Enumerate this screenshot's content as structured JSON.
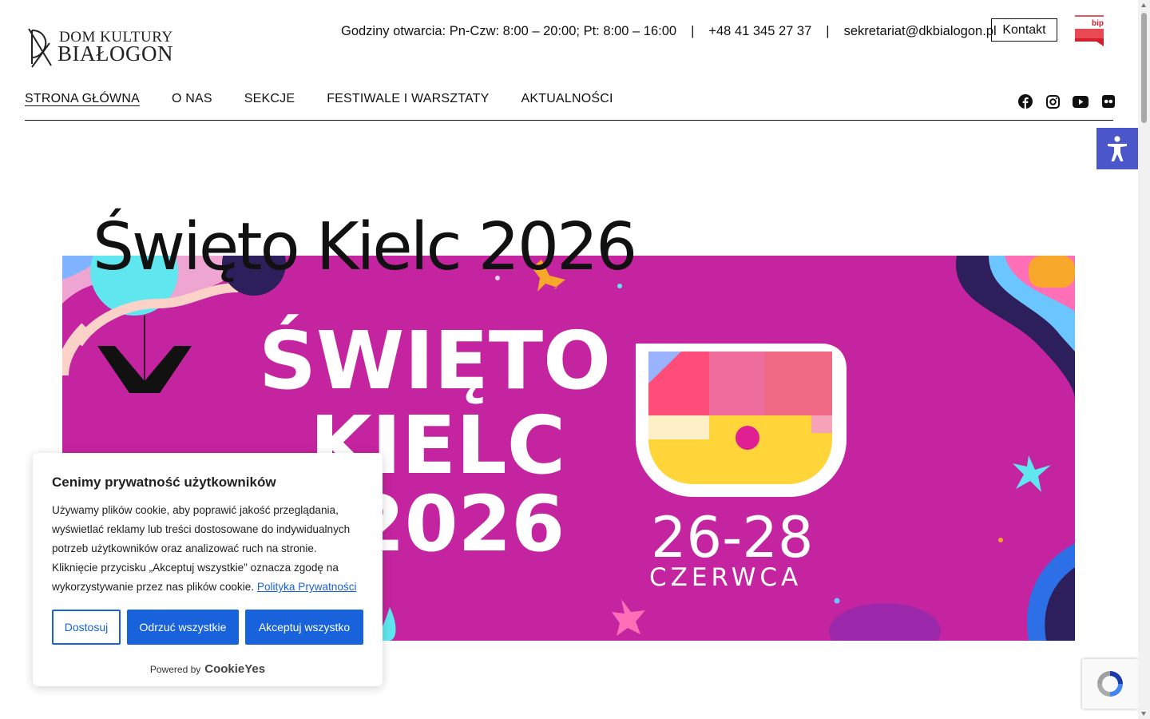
{
  "logo": {
    "line1": "DOM KULTURY",
    "line2": "BIAŁOGON"
  },
  "topbar": {
    "hours": "Godziny otwarcia: Pn-Czw: 8:00 – 20:00; Pt: 8:00 – 16:00",
    "separator": "|",
    "phone": "+48 41 345 27 37",
    "email": "sekretariat@dkbialogon.pl",
    "contact_button": "Kontakt",
    "bip_label": "bip"
  },
  "nav": {
    "items": [
      {
        "label": "STRONA GŁÓWNA",
        "active": true
      },
      {
        "label": "O NAS"
      },
      {
        "label": "SEKCJE"
      },
      {
        "label": "FESTIWALE I WARSZTATY"
      },
      {
        "label": "AKTUALNOŚCI"
      }
    ],
    "social": [
      "facebook-icon",
      "instagram-icon",
      "youtube-icon",
      "flickr-icon"
    ]
  },
  "hero": {
    "title": "Święto Kielc 2026",
    "banner": {
      "line1": "ŚWIĘTO",
      "line2": "KIELC",
      "line3": "2026",
      "dates": "26-28",
      "month": "CZERWCA",
      "bg_color": "#c4249f"
    }
  },
  "cookie": {
    "title": "Cenimy prywatność użytkowników",
    "body": "Używamy plików cookie, aby poprawić jakość przeglądania, wyświetlać reklamy lub treści dostosowane do indywidualnych potrzeb użytkowników oraz analizować ruch na stronie. Kliknięcie przycisku „Akceptuj wszystkie” oznacza zgodę na wykorzystywanie przez nas plików cookie.",
    "policy_link": "Polityka Prywatności",
    "customize": "Dostosuj",
    "reject": "Odrzuć wszystkie",
    "accept": "Akceptuj wszystko",
    "powered_by": "Powered by",
    "brand": "CookieYes",
    "accent": "#1863dc"
  },
  "colors": {
    "accessibility": "#4a56c9",
    "bip_red": "#d21f2b"
  }
}
